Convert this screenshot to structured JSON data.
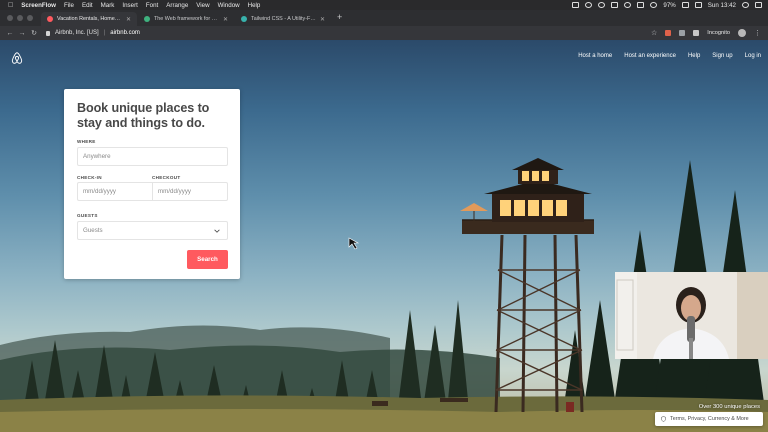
{
  "menubar": {
    "app": "ScreenFlow",
    "items": [
      "File",
      "Edit",
      "Mark",
      "Insert",
      "Font",
      "Arrange",
      "View",
      "Window",
      "Help"
    ],
    "battery": "97%",
    "clock": "Sun 13:42"
  },
  "tabs": [
    {
      "title": "Vacation Rentals, Homes, Expe",
      "favicon_color": "#ff5a5f",
      "active": true
    },
    {
      "title": "The Web framework for perfec",
      "favicon_color": "#3fb27f",
      "active": false
    },
    {
      "title": "Tailwind CSS - A Utility-First C",
      "favicon_color": "#38b2ac",
      "active": false
    }
  ],
  "addressbar": {
    "org": "Airbnb, Inc. [US]",
    "url": "airbnb.com",
    "profile": "Incognito"
  },
  "site": {
    "nav": [
      "Host a home",
      "Host an experience",
      "Help",
      "Sign up",
      "Log in"
    ],
    "brand_color": "#ff5a5f"
  },
  "search": {
    "heading": "Book unique places to stay and things to do.",
    "where_label": "WHERE",
    "where_placeholder": "Anywhere",
    "checkin_label": "CHECK-IN",
    "checkout_label": "CHECKOUT",
    "date_placeholder": "mm/dd/yyyy",
    "guests_label": "GUESTS",
    "guests_value": "Guests",
    "button": "Search"
  },
  "footer": {
    "places": "Over 300 unique places",
    "terms": "Terms, Privacy, Currency & More"
  }
}
